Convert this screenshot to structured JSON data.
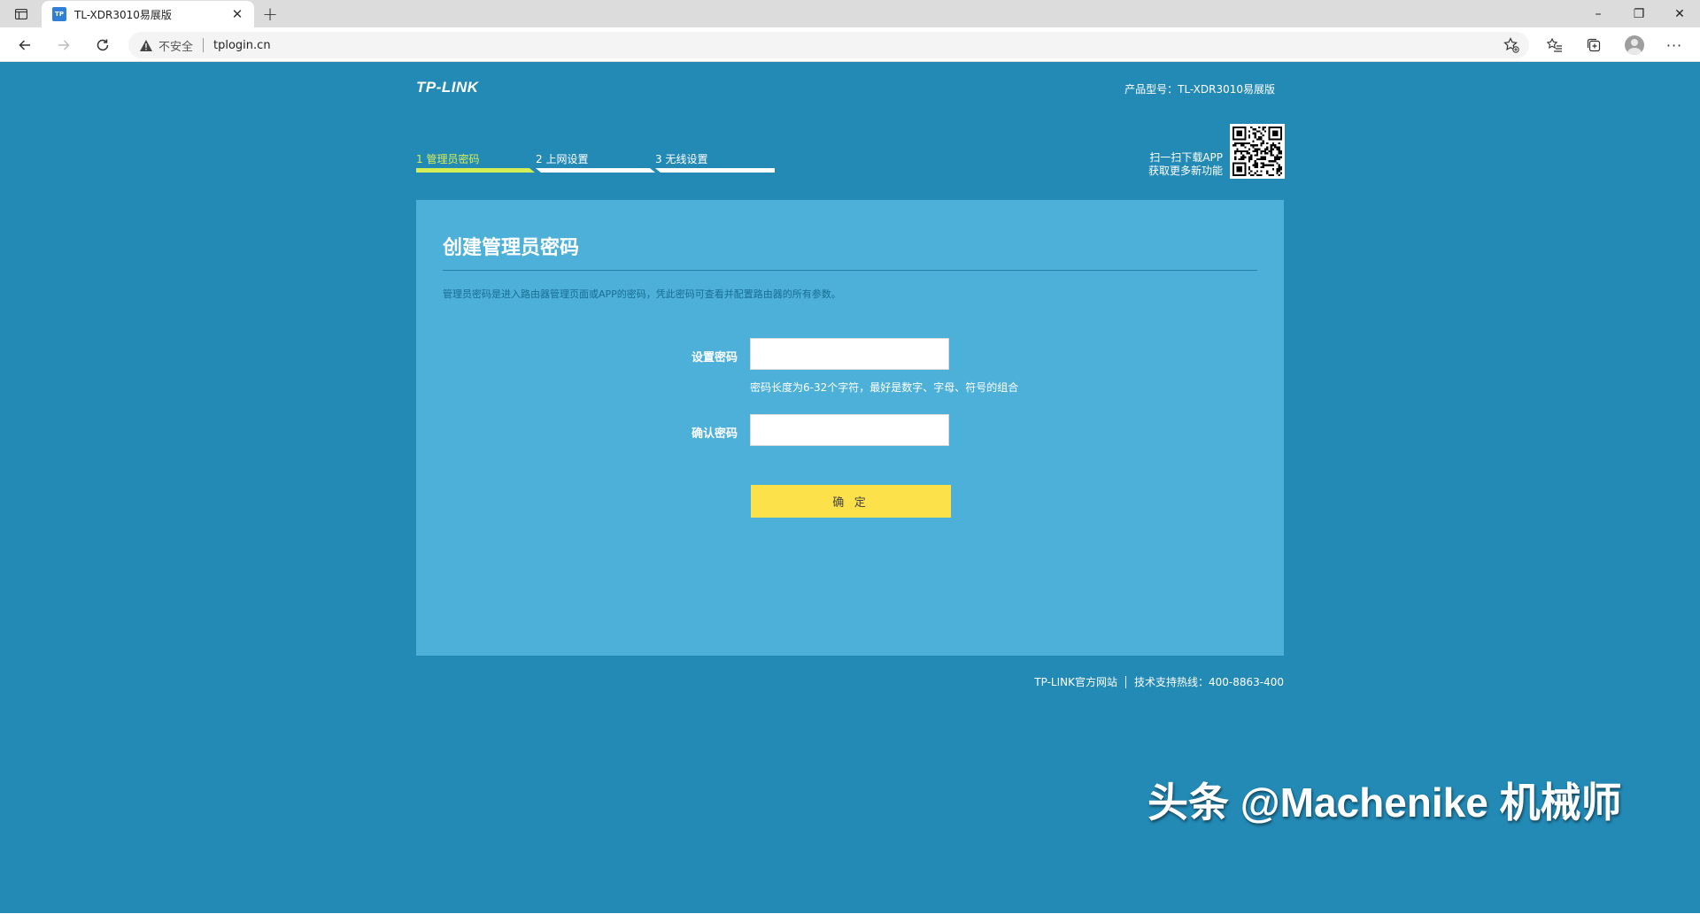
{
  "browser": {
    "tab_title": "TL-XDR3010易展版",
    "tab_favicon_text": "TP",
    "security_label": "不安全",
    "url": "tplogin.cn",
    "icons": {
      "tab_actions": "tab-actions-icon",
      "new_tab": "plus-icon",
      "back": "arrow-left-icon",
      "forward": "arrow-right-icon",
      "reload": "reload-icon",
      "warning": "warning-triangle-icon",
      "add_favorite": "star-plus-icon",
      "favorites": "favorites-list-icon",
      "collections": "collections-icon",
      "profile": "profile-avatar-icon",
      "more": "more-dots-icon"
    },
    "window_controls": {
      "minimize": "–",
      "restore": "❐",
      "close": "✕"
    },
    "more_label": "···"
  },
  "header": {
    "logo": "TP-LINK",
    "model_text": "产品型号：TL-XDR3010易展版"
  },
  "steps": [
    {
      "label": "1 管理员密码",
      "active": true
    },
    {
      "label": "2 上网设置",
      "active": false
    },
    {
      "label": "3 无线设置",
      "active": false
    }
  ],
  "app_promo": {
    "line1": "扫一扫下载APP",
    "line2": "获取更多新功能"
  },
  "card": {
    "title": "创建管理员密码",
    "description": "管理员密码是进入路由器管理页面或APP的密码，凭此密码可查看并配置路由器的所有参数。",
    "password_label": "设置密码",
    "password_value": "",
    "password_hint": "密码长度为6-32个字符，最好是数字、字母、符号的组合",
    "confirm_label": "确认密码",
    "confirm_value": "",
    "submit_label": "确 定"
  },
  "footer": {
    "official_site": "TP-LINK官方网站",
    "hotline": "技术支持热线：400-8863-400"
  },
  "watermark": "头条 @Machenike 机械师",
  "colors": {
    "page_bg": "#238ab6",
    "card_bg": "#4cb0d9",
    "active_step": "#d4ee58",
    "button": "#fde14a",
    "tabbar": "#dcdcdc"
  }
}
